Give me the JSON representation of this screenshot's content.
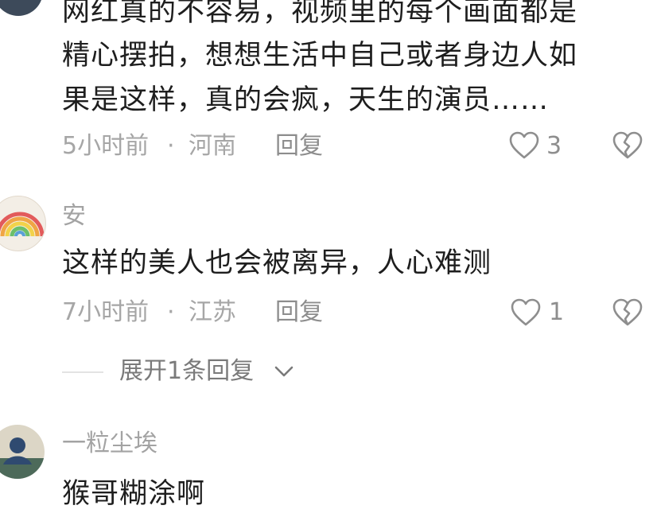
{
  "comments": [
    {
      "text_lines": [
        "网红真的不容易，视频里的每个画面都是",
        "精心摆拍，想想生活中自己或者身边人如",
        "果是这样，真的会疯，天生的演员……"
      ],
      "time": "5小时前",
      "separator": "·",
      "location": "河南",
      "reply_label": "回复",
      "likes": "3"
    },
    {
      "username": "安",
      "text_lines": [
        "这样的美人也会被离异，人心难测"
      ],
      "time": "7小时前",
      "separator": "·",
      "location": "江苏",
      "reply_label": "回复",
      "likes": "1",
      "expand_label": "展开1条回复"
    },
    {
      "username": "一粒尘埃",
      "text_lines": [
        "猴哥糊涂啊"
      ]
    }
  ],
  "icons": {
    "like": "heart-outline-icon",
    "dislike": "broken-heart-icon",
    "expand": "chevron-down-icon"
  },
  "colors": {
    "text": "#1e1e1e",
    "meta": "#a6a6a6",
    "icon": "#8e8e8e"
  }
}
